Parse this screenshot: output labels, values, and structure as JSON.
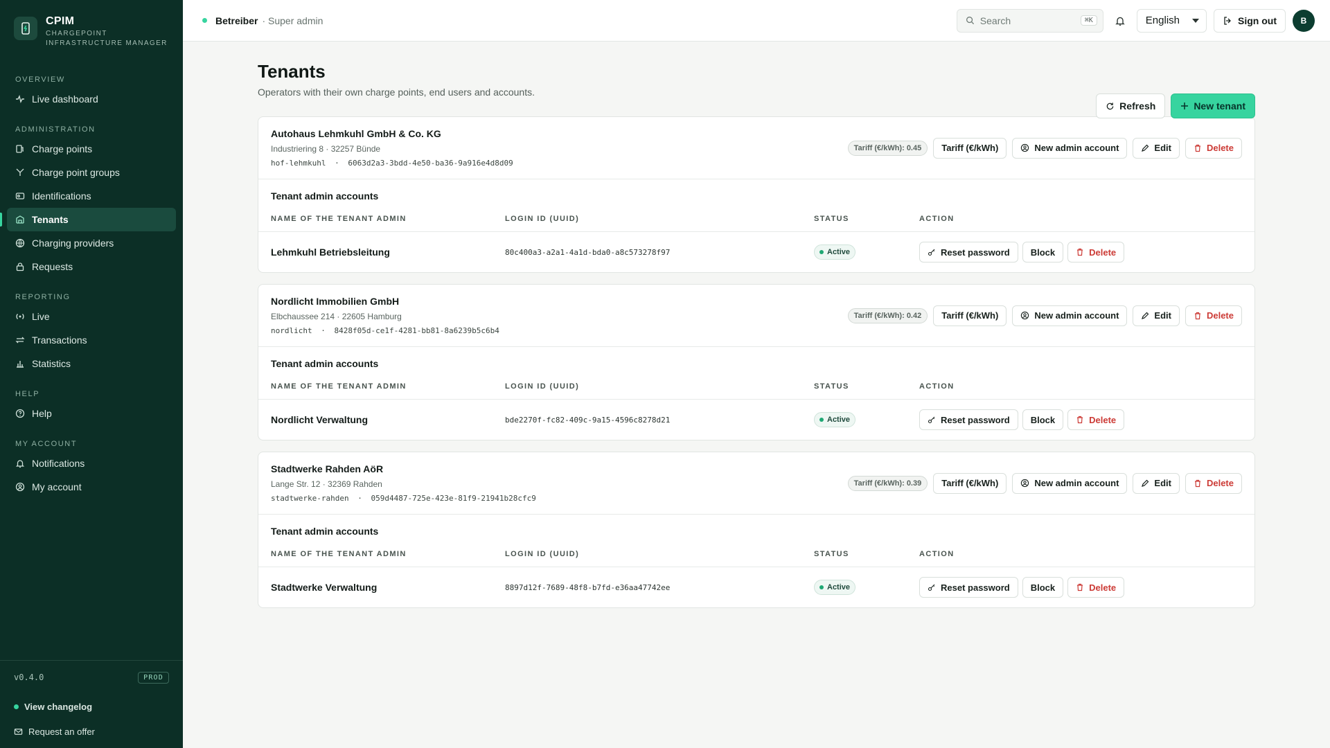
{
  "brand": {
    "title": "CPIM",
    "subtitle_line1": "CHARGEPOINT",
    "subtitle_line2": "INFRASTRUCTURE MANAGER"
  },
  "nav": {
    "overview": {
      "heading": "OVERVIEW",
      "items": [
        {
          "label": "Live dashboard"
        }
      ]
    },
    "administration": {
      "heading": "ADMINISTRATION",
      "items": [
        {
          "label": "Charge points"
        },
        {
          "label": "Charge point groups"
        },
        {
          "label": "Identifications"
        },
        {
          "label": "Tenants"
        },
        {
          "label": "Charging providers"
        },
        {
          "label": "Requests"
        }
      ]
    },
    "reporting": {
      "heading": "REPORTING",
      "items": [
        {
          "label": "Live"
        },
        {
          "label": "Transactions"
        },
        {
          "label": "Statistics"
        }
      ]
    },
    "help": {
      "heading": "HELP",
      "items": [
        {
          "label": "Help"
        }
      ]
    },
    "account": {
      "heading": "MY ACCOUNT",
      "items": [
        {
          "label": "Notifications"
        },
        {
          "label": "My account"
        }
      ]
    }
  },
  "footer": {
    "version": "v0.4.0",
    "env": "PROD",
    "changelog": "View changelog",
    "offer": "Request an offer"
  },
  "topbar": {
    "context_name": "Betreiber",
    "context_role": "· Super admin",
    "search_placeholder": "Search",
    "search_shortcut": "⌘K",
    "language": "English",
    "signout": "Sign out",
    "avatar_initial": "B"
  },
  "page": {
    "title": "Tenants",
    "subtitle": "Operators with their own charge points, end users and accounts.",
    "refresh": "Refresh",
    "new_tenant": "New tenant"
  },
  "labels": {
    "tariff_button": "Tariff (€/kWh)",
    "new_admin": "New admin account",
    "edit": "Edit",
    "delete": "Delete",
    "accounts_title": "Tenant admin accounts",
    "col_name": "NAME OF THE TENANT ADMIN",
    "col_login": "LOGIN ID (UUID)",
    "col_status": "STATUS",
    "col_action": "ACTION",
    "reset_password": "Reset password",
    "block": "Block"
  },
  "tenants": [
    {
      "name": "Autohaus Lehmkuhl GmbH & Co. KG",
      "address": "Industriering 8 · 32257 Bünde",
      "slug": "hof-lehmkuhl",
      "sep": "·",
      "uuid": "6063d2a3-3bdd-4e50-ba36-9a916e4d8d09",
      "tariff": "Tariff (€/kWh): 0.45",
      "admin": {
        "name": "Lehmkuhl Betriebsleitung",
        "login": "80c400a3-a2a1-4a1d-bda0-a8c573278f97",
        "status": "Active"
      }
    },
    {
      "name": "Nordlicht Immobilien GmbH",
      "address": "Elbchaussee 214 · 22605 Hamburg",
      "slug": "nordlicht",
      "sep": "·",
      "uuid": "8428f05d-ce1f-4281-bb81-8a6239b5c6b4",
      "tariff": "Tariff (€/kWh): 0.42",
      "admin": {
        "name": "Nordlicht Verwaltung",
        "login": "bde2270f-fc82-409c-9a15-4596c8278d21",
        "status": "Active"
      }
    },
    {
      "name": "Stadtwerke Rahden AöR",
      "address": "Lange Str. 12 · 32369 Rahden",
      "slug": "stadtwerke-rahden",
      "sep": "·",
      "uuid": "059d4487-725e-423e-81f9-21941b28cfc9",
      "tariff": "Tariff (€/kWh): 0.39",
      "admin": {
        "name": "Stadtwerke Verwaltung",
        "login": "8897d12f-7689-48f8-b7fd-e36aa47742ee",
        "status": "Active"
      }
    }
  ]
}
